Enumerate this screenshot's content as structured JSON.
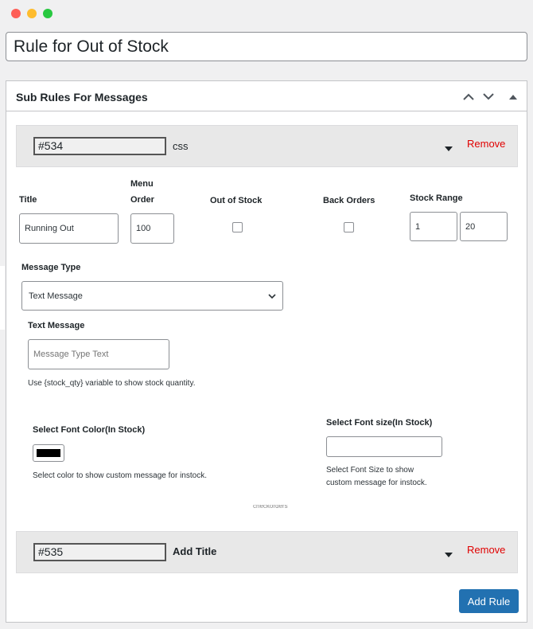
{
  "window": {
    "controls": [
      "close",
      "minimize",
      "maximize"
    ]
  },
  "post_title": "Rule for Out of Stock",
  "panel": {
    "title": "Sub Rules For Messages",
    "controls": [
      "chevron-up-icon",
      "chevron-down-icon",
      "caret-up-icon"
    ]
  },
  "rules": [
    {
      "id": "#534",
      "name": "css",
      "remove_label": "Remove"
    },
    {
      "id": "#535",
      "name": "Add Title",
      "remove_label": "Remove"
    }
  ],
  "fields": {
    "title_label": "Title",
    "title_value": "Running Out",
    "menu_order_label_1": "Menu",
    "menu_order_label_2": "Order",
    "menu_order_value": "100",
    "out_of_stock_label": "Out of Stock",
    "out_of_stock_checked": false,
    "back_orders_label": "Back Orders",
    "back_orders_checked": false,
    "stock_range_label": "Stock Range",
    "stock_range_min": "1",
    "stock_range_max": "20",
    "message_type_label": "Message Type",
    "message_type_value": "Text Message",
    "text_message_label": "Text Message",
    "text_message_placeholder": "Message Type Text",
    "text_message_help": "Use {stock_qty} variable to show stock quantity.",
    "font_color_label": "Select Font Color(In Stock)",
    "font_color_value": "#000000",
    "font_color_help": "Select color to show custom message for instock.",
    "font_size_label": "Select Font size(In Stock)",
    "font_size_value": "",
    "font_size_help_1": "Select Font Size to show",
    "font_size_help_2": "custom message for instock.",
    "truncated_text": "checkorders"
  },
  "add_rule_label": "Add Rule",
  "colors": {
    "accent": "#2271b1",
    "remove": "#e00000",
    "rule_bar": "#e8e8e8"
  }
}
